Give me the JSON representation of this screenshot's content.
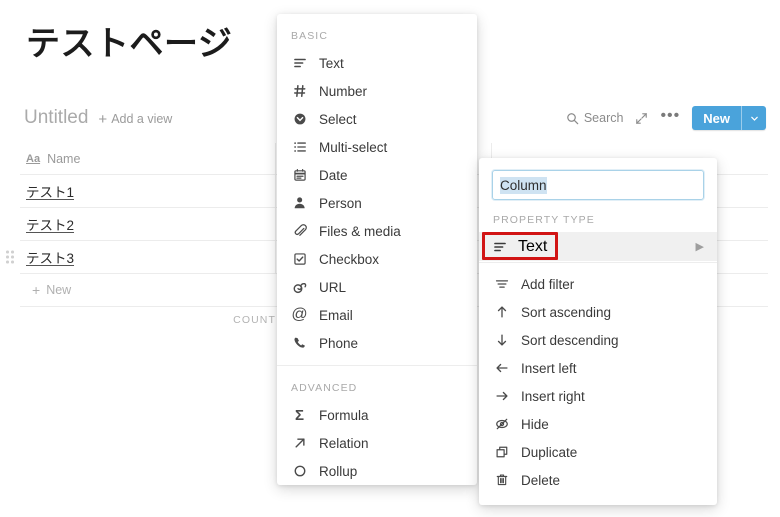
{
  "page": {
    "title": "テストページ"
  },
  "view": {
    "name": "Untitled",
    "add_view_label": "Add a view",
    "add_view_icon": "plus-icon"
  },
  "toolbar": {
    "search_label": "Search",
    "search_icon": "search-icon",
    "expand_icon": "expand-diagonal-icon",
    "more_icon": "ellipsis-icon",
    "new_label": "New",
    "new_caret_icon": "chevron-down-icon",
    "new_button_color": "#4aa3db"
  },
  "table": {
    "columns": [
      {
        "label": "Name",
        "icon": "text-aa-icon"
      }
    ],
    "rows": [
      {
        "name": "テスト1"
      },
      {
        "name": "テスト2"
      },
      {
        "name": "テスト3"
      }
    ],
    "new_row_label": "New",
    "new_row_icon": "plus-icon",
    "drag_handle_icon": "drag-dots-icon",
    "footer_label": "COUNT"
  },
  "type_menu": {
    "sections": [
      {
        "label": "BASIC",
        "items": [
          {
            "label": "Text",
            "icon": "text-lines-icon"
          },
          {
            "label": "Number",
            "icon": "hash-icon"
          },
          {
            "label": "Select",
            "icon": "circle-chevron-icon"
          },
          {
            "label": "Multi-select",
            "icon": "list-icon"
          },
          {
            "label": "Date",
            "icon": "calendar-icon"
          },
          {
            "label": "Person",
            "icon": "person-icon"
          },
          {
            "label": "Files & media",
            "icon": "paperclip-icon"
          },
          {
            "label": "Checkbox",
            "icon": "checkbox-icon"
          },
          {
            "label": "URL",
            "icon": "link-icon"
          },
          {
            "label": "Email",
            "icon": "at-icon"
          },
          {
            "label": "Phone",
            "icon": "phone-icon"
          }
        ]
      },
      {
        "label": "ADVANCED",
        "items": [
          {
            "label": "Formula",
            "icon": "sigma-icon"
          },
          {
            "label": "Relation",
            "icon": "arrow-up-right-icon"
          },
          {
            "label": "Rollup",
            "icon": "rollup-icon"
          }
        ]
      }
    ]
  },
  "column_menu": {
    "name_value": "Column",
    "property_type_label": "PROPERTY TYPE",
    "property_type_value": "Text",
    "property_type_icon": "text-lines-icon",
    "property_type_caret": "caret-right-icon",
    "highlight_color": "#d11414",
    "actions": [
      {
        "label": "Add filter",
        "icon": "filter-icon"
      },
      {
        "label": "Sort ascending",
        "icon": "arrow-up-icon"
      },
      {
        "label": "Sort descending",
        "icon": "arrow-down-icon"
      },
      {
        "label": "Insert left",
        "icon": "arrow-left-icon"
      },
      {
        "label": "Insert right",
        "icon": "arrow-right-icon"
      },
      {
        "label": "Hide",
        "icon": "eye-off-icon"
      },
      {
        "label": "Duplicate",
        "icon": "copy-icon"
      },
      {
        "label": "Delete",
        "icon": "trash-icon"
      }
    ]
  }
}
